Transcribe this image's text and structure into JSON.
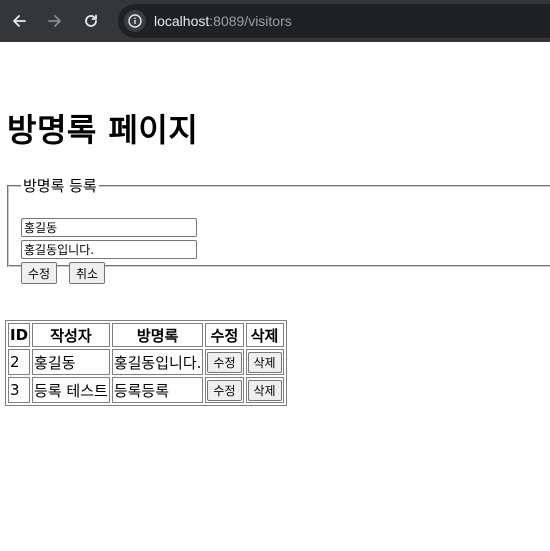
{
  "browser": {
    "url_host": "localhost",
    "url_rest": ":8089/visitors"
  },
  "page": {
    "title": "방명록 페이지"
  },
  "form": {
    "legend": "방명록 등록",
    "name_value": "홍길동",
    "content_value": "홍길동입니다.",
    "edit_button": "수정",
    "cancel_button": "취소"
  },
  "table": {
    "headers": [
      "ID",
      "작성자",
      "방명록",
      "수정",
      "삭제"
    ],
    "rows": [
      {
        "id": "2",
        "writer": "홍길동",
        "content": "홍길동입니다.",
        "edit": "수정",
        "delete": "삭제"
      },
      {
        "id": "3",
        "writer": "등록 테스트",
        "content": "등록등록",
        "edit": "수정",
        "delete": "삭제"
      }
    ]
  }
}
